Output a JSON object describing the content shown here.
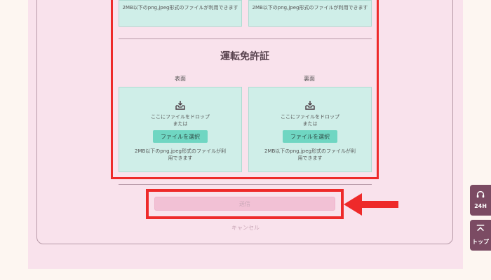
{
  "form": {
    "top_zone_help": "2MB以下のpng,jpeg形式のファイルが利用できます",
    "section_title": "運転免許証",
    "front_label": "表面",
    "back_label": "裏面",
    "drop_text": "ここにファイルをドロップ",
    "or_text": "または",
    "select_button": "ファイルを選択",
    "help_text": "2MB以下のpng,jpeg形式のファイルが利用できます",
    "submit_label": "送信",
    "cancel_label": "キャンセル"
  },
  "side_buttons": {
    "support_label": "24H",
    "top_label": "トップ"
  },
  "colors": {
    "highlight": "#ee2a2a",
    "upload_zone": "#cfeee8",
    "select_button": "#6fd6c2",
    "side_button": "#7b4b63",
    "submit_disabled": "#f2c1d5"
  }
}
